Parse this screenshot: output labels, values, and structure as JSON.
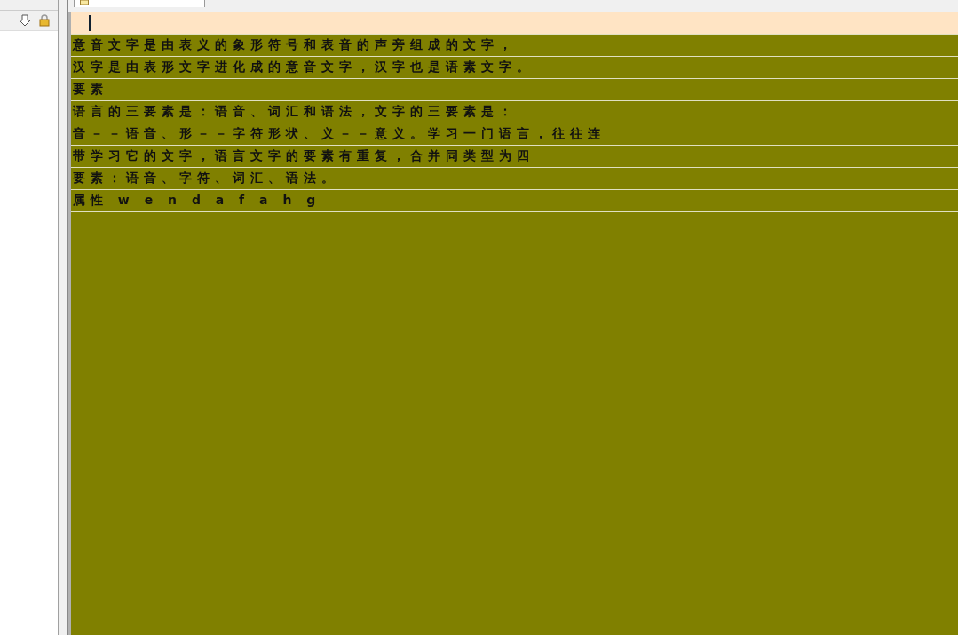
{
  "sidebar": {
    "toolbar": [
      {
        "kind": "down"
      },
      {
        "kind": "lock"
      }
    ]
  },
  "tab": {
    "selected": true
  },
  "editor": {
    "lines": [
      {
        "current": true
      },
      {
        "current": false,
        "text": "意音文字是由表义的象形符号和表音的声旁组成的文字，"
      },
      {
        "current": false,
        "text": "汉字是由表形文字进化成的意音文字，汉字也是语素文字。"
      },
      {
        "current": false,
        "text": "要素"
      },
      {
        "current": false,
        "text": "语言的三要素是：语音、词汇和语法，文字的三要素是："
      },
      {
        "current": false,
        "text": "音－－语音、形－－字符形状、义－－意义。学习一门语言，往往连"
      },
      {
        "current": false,
        "text": "带学习它的文字，语言文字的要素有重复，合并同类型为四"
      },
      {
        "current": false,
        "text": "要素：语音、字符、词汇、语法。"
      },
      {
        "current": false,
        "text": "属性 w e n d a f a h g"
      },
      {
        "current": false
      }
    ]
  }
}
